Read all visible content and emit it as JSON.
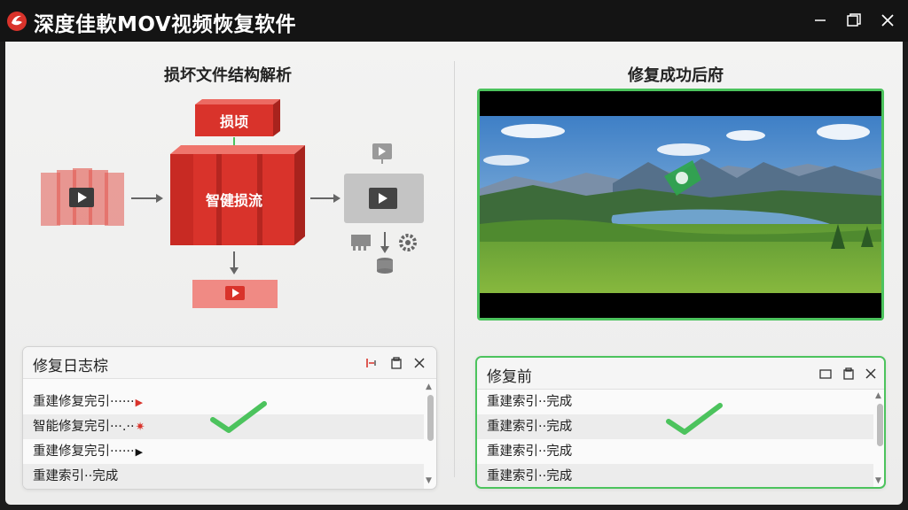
{
  "app": {
    "title": "深度佳軟MOV视频恢复软件"
  },
  "left": {
    "title": "损坏文件结构解析",
    "diagram": {
      "damaged_label": "损顷",
      "core_label": "智健损流"
    },
    "log": {
      "title": "修复日志棕",
      "rows": [
        {
          "text": "重建修复完引······",
          "marker": "▶"
        },
        {
          "text": "智能修复完引···.··",
          "marker": "✷"
        },
        {
          "text": "重建修复完引······",
          "marker": "▶"
        },
        {
          "text": "重建索引··完成",
          "marker": ""
        }
      ]
    }
  },
  "right": {
    "title": "修复成功后府",
    "log": {
      "title": "修复前",
      "rows": [
        {
          "text": "重建索引··完成"
        },
        {
          "text": "重建索引··完成"
        },
        {
          "text": "重建索引··完成"
        },
        {
          "text": "重建索引··完成"
        }
      ]
    }
  },
  "colors": {
    "accent_red": "#d9332b",
    "success_green": "#4cc35d",
    "titlebar": "#141414"
  }
}
